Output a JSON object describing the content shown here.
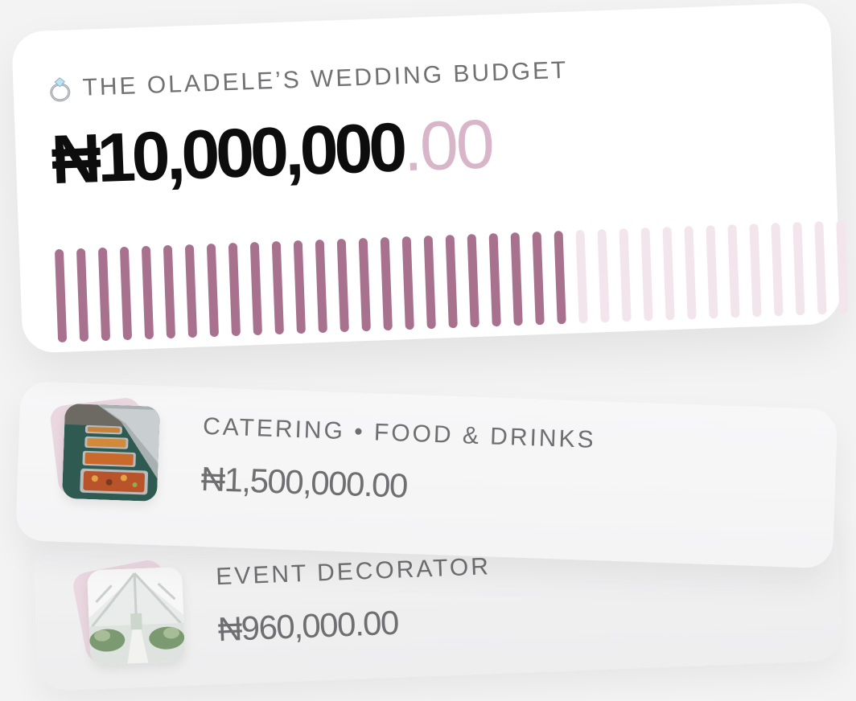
{
  "budget": {
    "ring_icon": "ring-icon",
    "title": "THE OLADELE’S WEDDING BUDGET",
    "amount_main": "₦10,000,000",
    "amount_decimal": ".00",
    "progress": {
      "total_ticks": 37,
      "filled_ticks": 24,
      "filled_color": "#a8728f",
      "empty_color": "#f3e5ec"
    }
  },
  "expenses": [
    {
      "label": "CATERING • FOOD & DRINKS",
      "amount": "₦1,500,000.00",
      "thumb_icon": "catering-food-image"
    },
    {
      "label": "EVENT DECORATOR",
      "amount": "₦960,000.00",
      "thumb_icon": "event-venue-image"
    }
  ],
  "colors": {
    "accent": "#a8728f",
    "accent_light": "#d8b5c9",
    "thumb_back": "#ead7e0",
    "text_muted": "#6f6f72"
  }
}
